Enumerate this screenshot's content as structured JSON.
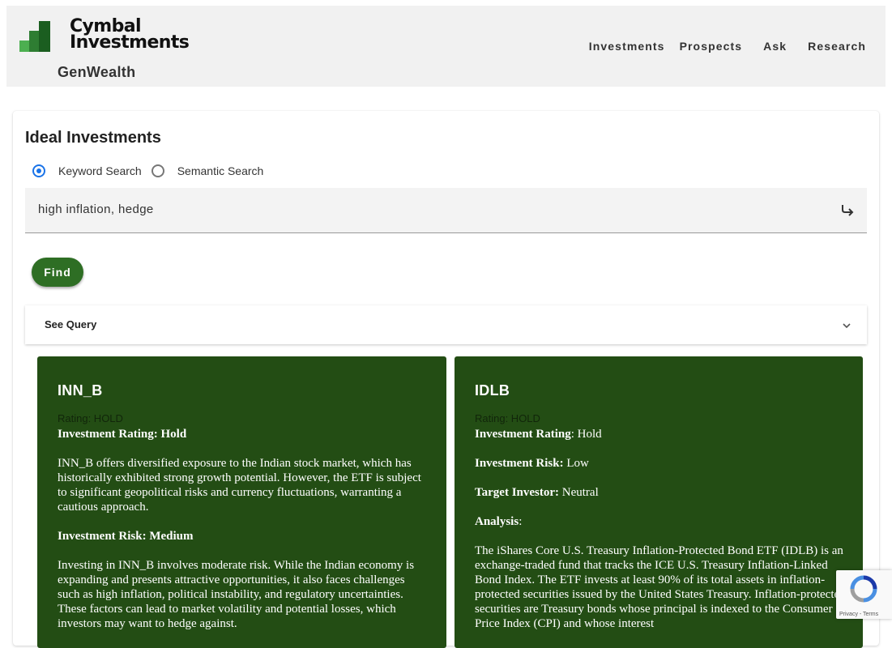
{
  "header": {
    "logo_line1": "Cymbal",
    "logo_line2": "Investments",
    "product": "GenWealth",
    "nav": [
      "Investments",
      "Prospects",
      "Ask",
      "Research"
    ]
  },
  "main": {
    "title": "Ideal Investments",
    "search_modes": [
      {
        "label": "Keyword Search",
        "selected": true
      },
      {
        "label": "Semantic Search",
        "selected": false
      }
    ],
    "query": "high inflation, hedge",
    "find_label": "Find",
    "see_query_label": "See Query"
  },
  "results": [
    {
      "ticker": "INN_B",
      "rating_label": "Rating: HOLD",
      "investment_rating_label": "Investment Rating: Hold",
      "overview": "INN_B offers diversified exposure to the Indian stock market, which has historically exhibited strong growth potential. However, the ETF is subject to significant geopolitical risks and currency fluctuations, warranting a cautious approach.",
      "risk_label": "Investment Risk: Medium",
      "risk_text": "Investing in INN_B involves moderate risk. While the Indian economy is expanding and presents attractive opportunities, it also faces challenges such as high inflation, political instability, and regulatory uncertainties. These factors can lead to market volatility and potential losses, which investors may want to hedge against."
    },
    {
      "ticker": "IDLB",
      "rating_label": "Rating: HOLD",
      "investment_rating_key": "Investment Rating",
      "investment_rating_value": ": Hold",
      "risk_key": "Investment Risk:",
      "risk_value": " Low",
      "target_key": "Target Investor:",
      "target_value": " Neutral",
      "analysis_key": "Analysis",
      "analysis_colon": ":",
      "analysis_text": "The iShares Core U.S. Treasury Inflation-Protected Bond ETF (IDLB) is an exchange-traded fund that tracks the ICE U.S. Treasury Inflation-Linked Bond Index. The ETF invests at least 90% of its total assets in inflation-protected securities issued by the United States Treasury. Inflation-protected securities are Treasury bonds whose principal is indexed to the Consumer Price Index (CPI) and whose interest"
    }
  ],
  "recaptcha": {
    "links": "Privacy - Terms"
  },
  "colors": {
    "header_bg": "#f1f1f1",
    "accent_green": "#2e6e24",
    "result_bg": "#234d14",
    "radio_selected": "#1a73e8"
  }
}
